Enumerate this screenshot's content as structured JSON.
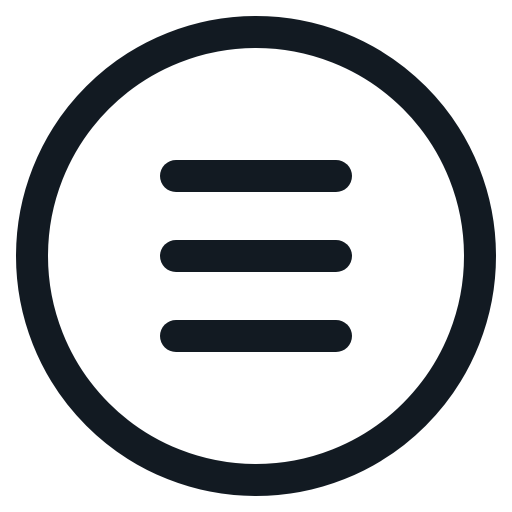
{
  "icon": {
    "name": "menu-circle-icon",
    "color": "#121a22",
    "background": "#ffffff"
  }
}
